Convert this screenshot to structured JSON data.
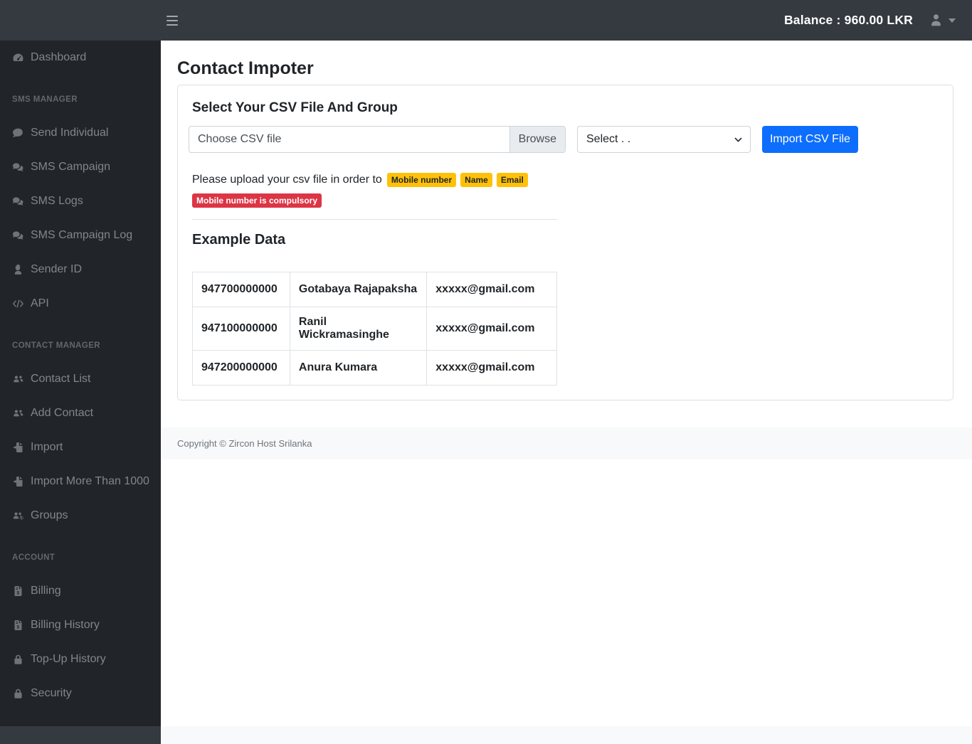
{
  "topbar": {
    "balance": "Balance : 960.00 LKR",
    "menu_icon": "bars-icon",
    "user_icon": "user-icon",
    "caret_icon": "caret-down-icon"
  },
  "sidebar": {
    "groups": [
      {
        "header": null,
        "items": [
          {
            "label": "Dashboard",
            "icon": "dashboard-icon"
          }
        ]
      },
      {
        "header": "SMS MANAGER",
        "items": [
          {
            "label": "Send Individual",
            "icon": "comment-icon"
          },
          {
            "label": "SMS Campaign",
            "icon": "comments-icon"
          },
          {
            "label": "SMS Logs",
            "icon": "comments-icon"
          },
          {
            "label": "SMS Campaign Log",
            "icon": "comments-icon"
          },
          {
            "label": "Sender ID",
            "icon": "user-secret-icon"
          },
          {
            "label": "API",
            "icon": "code-icon"
          }
        ]
      },
      {
        "header": "CONTACT MANAGER",
        "items": [
          {
            "label": "Contact List",
            "icon": "users-icon"
          },
          {
            "label": "Add Contact",
            "icon": "users-icon"
          },
          {
            "label": "Import",
            "icon": "file-import-icon"
          },
          {
            "label": "Import More Than 1000",
            "icon": "file-import-icon"
          },
          {
            "label": "Groups",
            "icon": "users-cog-icon"
          }
        ]
      },
      {
        "header": "ACCOUNT",
        "items": [
          {
            "label": "Billing",
            "icon": "file-invoice-icon"
          },
          {
            "label": "Billing History",
            "icon": "file-invoice-icon"
          },
          {
            "label": "Top-Up History",
            "icon": "lock-icon"
          },
          {
            "label": "Security",
            "icon": "lock-icon"
          }
        ]
      }
    ]
  },
  "main": {
    "page_title": "Contact Impoter",
    "card": {
      "title": "Select Your CSV File And Group",
      "file_input": {
        "placeholder": "Choose CSV file",
        "browse_label": "Browse"
      },
      "group_select": {
        "value": "Select . ."
      },
      "import_button": "Import CSV File",
      "hint_text": "Please upload your csv file in order to",
      "order_badges": [
        "Mobile number",
        "Name",
        "Email"
      ],
      "warning_badge": "Mobile number is compulsory",
      "example_heading": "Example Data",
      "example_table": {
        "rows": [
          [
            "947700000000",
            "Gotabaya Rajapaksha",
            "xxxxx@gmail.com"
          ],
          [
            "947100000000",
            "Ranil Wickramasinghe",
            "xxxxx@gmail.com"
          ],
          [
            "947200000000",
            "Anura Kumara",
            "xxxxx@gmail.com"
          ]
        ]
      }
    }
  },
  "footer": {
    "copyright": "Copyright © Zircon Host Srilanka"
  },
  "colors": {
    "topbar": "#343a40",
    "sidebar": "#212529",
    "primary": "#0d6efd",
    "badge_warning": "#ffc107",
    "badge_danger": "#dc3545",
    "footer_bg": "#f8f9fa"
  }
}
